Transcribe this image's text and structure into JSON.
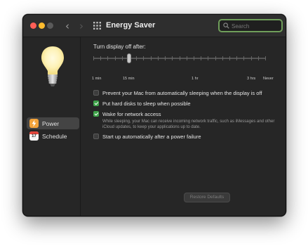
{
  "window": {
    "title": "Energy Saver",
    "back_icon": "chevron-left-icon",
    "forward_icon": "chevron-right-icon",
    "grid_icon": "show-all-grid-icon"
  },
  "search": {
    "placeholder": "Search",
    "value": ""
  },
  "sidebar": {
    "hero_icon": "light-bulb-icon",
    "items": [
      {
        "label": "Power",
        "icon": "lightning-bolt-icon",
        "selected": true
      },
      {
        "label": "Schedule",
        "icon": "calendar-icon",
        "calendar_number": "17",
        "selected": false
      }
    ]
  },
  "display_off": {
    "title": "Turn display off after:",
    "tick_labels": [
      "1 min",
      "15 min",
      "1 hr",
      "3 hrs",
      "Never"
    ],
    "selected": "15 min"
  },
  "options": [
    {
      "label": "Prevent your Mac from automatically sleeping when the display is off",
      "checked": false
    },
    {
      "label": "Put hard disks to sleep when possible",
      "checked": true
    },
    {
      "label": "Wake for network access",
      "checked": true,
      "description": "While sleeping, your Mac can receive incoming network traffic, such as iMessages and other iCloud updates, to keep your applications up to date."
    },
    {
      "label": "Start up automatically after a power failure",
      "checked": false
    }
  ],
  "footer": {
    "restore_label": "Restore Defaults",
    "help_label": "?"
  },
  "colors": {
    "accent": "#3fa34a",
    "search_ring": "#6f9e5a",
    "window_bg": "#262626"
  }
}
